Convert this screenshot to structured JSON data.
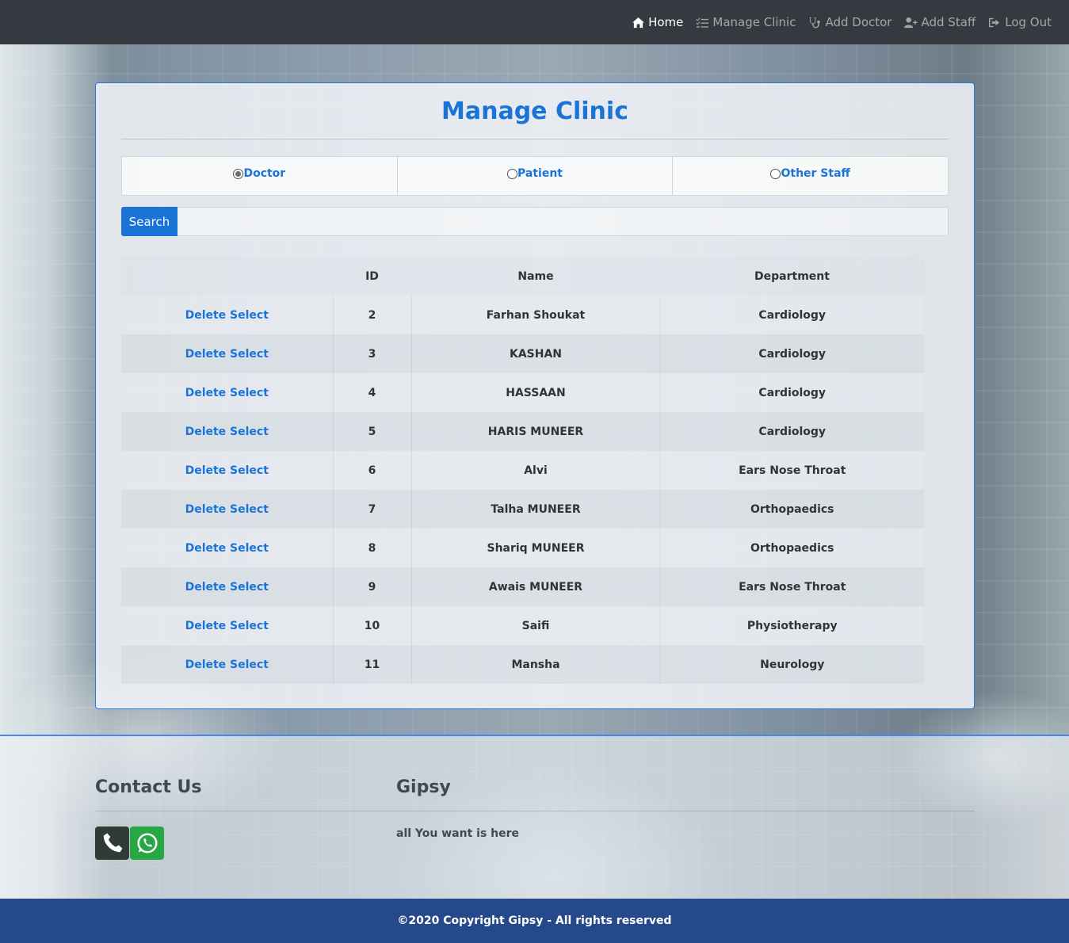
{
  "nav": {
    "items": [
      {
        "label": "Home",
        "icon": "home-icon",
        "active": true
      },
      {
        "label": "Manage Clinic",
        "icon": "list-check-icon",
        "active": false
      },
      {
        "label": "Add Doctor",
        "icon": "stethoscope-icon",
        "active": false
      },
      {
        "label": "Add Staff",
        "icon": "user-plus-icon",
        "active": false
      },
      {
        "label": "Log Out",
        "icon": "sign-out-icon",
        "active": false
      }
    ]
  },
  "card": {
    "title": "Manage Clinic",
    "radio_options": [
      {
        "label": "Doctor",
        "checked": true
      },
      {
        "label": "Patient",
        "checked": false
      },
      {
        "label": "Other Staff",
        "checked": false
      }
    ],
    "search": {
      "button_label": "Search",
      "value": "",
      "placeholder": ""
    }
  },
  "table": {
    "headers": [
      "",
      "ID",
      "Name",
      "Department"
    ],
    "action_label": "Delete Select",
    "rows": [
      {
        "id": "2",
        "name": "Farhan Shoukat",
        "department": "Cardiology"
      },
      {
        "id": "3",
        "name": "KASHAN",
        "department": "Cardiology"
      },
      {
        "id": "4",
        "name": "HASSAAN",
        "department": "Cardiology"
      },
      {
        "id": "5",
        "name": "HARIS MUNEER",
        "department": "Cardiology"
      },
      {
        "id": "6",
        "name": "Alvi",
        "department": "Ears Nose Throat"
      },
      {
        "id": "7",
        "name": "Talha MUNEER",
        "department": "Orthopaedics"
      },
      {
        "id": "8",
        "name": "Shariq MUNEER",
        "department": "Orthopaedics"
      },
      {
        "id": "9",
        "name": "Awais MUNEER",
        "department": "Ears Nose Throat"
      },
      {
        "id": "10",
        "name": "Saifi",
        "department": "Physiotherapy"
      },
      {
        "id": "11",
        "name": "Mansha",
        "department": "Neurology"
      }
    ]
  },
  "footer": {
    "contact_heading": "Contact Us",
    "brand_heading": "Gipsy",
    "brand_text": "all You want is here",
    "contact_icons": [
      {
        "icon": "phone-icon",
        "color": "#2f3b36"
      },
      {
        "icon": "whatsapp-icon",
        "color": "#28a745"
      }
    ],
    "copyright": "©2020 Copyright Gipsy - All rights reserved"
  },
  "colors": {
    "accent": "#1a74d8",
    "navbar": "#343a40",
    "footer_bottom": "#25498a"
  }
}
